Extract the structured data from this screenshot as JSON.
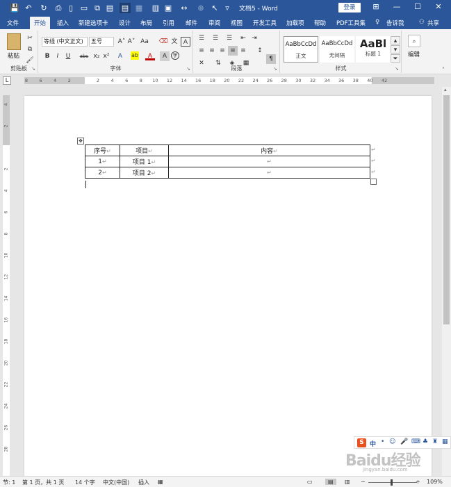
{
  "title": {
    "doc": "文档5 - Word",
    "login": "登录",
    "min": "—",
    "max": "☐",
    "close": "✕",
    "ribbon_opt": "⊞"
  },
  "qa": {
    "save": "💾",
    "undo": "↶",
    "redo": "↻"
  },
  "tabs": [
    "文件",
    "开始",
    "插入",
    "新建选项卡",
    "设计",
    "布局",
    "引用",
    "邮件",
    "审阅",
    "视图",
    "开发工具",
    "加载项",
    "帮助",
    "PDF工具集",
    "告诉我",
    "共享"
  ],
  "ribbon": {
    "paste": "粘贴",
    "clipboard": "剪贴板",
    "font_name": "等线 (中文正文)",
    "font_size": "五号",
    "font_group": "字体",
    "para_group": "段落",
    "styles_group": "样式",
    "edit_label": "编辑",
    "fmt": {
      "bold": "B",
      "italic": "I",
      "underline": "U",
      "strike": "abc",
      "sub": "x₂",
      "sup": "x²",
      "grow": "A˄",
      "shrink": "A˅",
      "case": "Aa",
      "color": "A",
      "high": "ab"
    },
    "styles": [
      {
        "preview": "AaBbCcDd",
        "name": "正文"
      },
      {
        "preview": "AaBbCcDd",
        "name": "无间隔"
      },
      {
        "preview": "AaBl",
        "name": "标题 1"
      }
    ]
  },
  "ruler_h": [
    "8",
    "6",
    "4",
    "2",
    "",
    "2",
    "4",
    "6",
    "8",
    "10",
    "12",
    "14",
    "16",
    "18",
    "20",
    "22",
    "24",
    "26",
    "28",
    "30",
    "32",
    "34",
    "36",
    "38",
    "40",
    "42"
  ],
  "ruler_v": [
    "4",
    "2",
    "",
    "2",
    "4",
    "6",
    "8",
    "10",
    "12",
    "14",
    "16",
    "18",
    "20",
    "22",
    "24",
    "26",
    "28"
  ],
  "table": {
    "headers": [
      "序号",
      "项目",
      "内容"
    ],
    "rows": [
      [
        "1",
        "项目 1",
        ""
      ],
      [
        "2",
        "项目 2",
        ""
      ]
    ]
  },
  "status": {
    "page": "节: 1",
    "pages": "第 1 页，共 1 页",
    "words": "14 个字",
    "lang": "中文(中国)",
    "mode": "插入",
    "zoom": "109%"
  },
  "watermark": {
    "logo": "Baidu经验",
    "url": "jingyan.baidu.com",
    "ime": "中"
  }
}
